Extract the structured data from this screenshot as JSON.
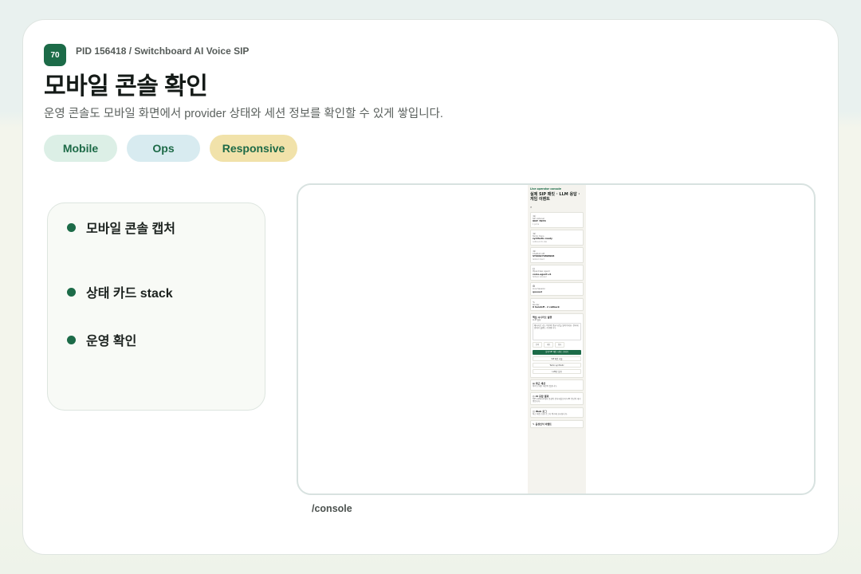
{
  "header": {
    "badge": "70",
    "pid": "PID 156418 / Switchboard AI Voice SIP",
    "title": "모바일 콘솔 확인",
    "subtitle": "운영 콘솔도 모바일 화면에서 provider 상태와 세션 정보를 확인할 수 있게 쌓입니다."
  },
  "tags": [
    "Mobile",
    "Ops",
    "Responsive"
  ],
  "checklist": [
    "모바일 콘솔 캡처",
    "상태 카드 stack",
    "운영 확인"
  ],
  "route": "/console",
  "phone": {
    "top_label": "Live operator console",
    "title": "실제 SIP 패킷 · LLM 응답 · 게임 이벤트",
    "search_icon": "⌕",
    "status_cards": [
      {
        "icon": "☏",
        "label": "SIP Listener",
        "value": "UDP :5070",
        "note": "1 pcma"
      },
      {
        "icon": "☏",
        "label": "Twilio trans",
        "value": "synthetic-ready",
        "note": "outbound to dial"
      },
      {
        "icon": "☏",
        "label": "Chatbot API",
        "value": "ST000279898908",
        "note": "talkbot intent"
      },
      {
        "icon": "◻",
        "label": "OpenClaw Agent",
        "value": "voice-agent-v1",
        "note": "fallback allowed"
      },
      {
        "icon": "⚙",
        "label": "Live Session",
        "value": "queued",
        "note": ""
      },
      {
        "icon": "∿",
        "label": "Router",
        "value": "0 handoff · 2 callback",
        "note": ""
      }
    ],
    "scenario": {
      "title": "핵심 시나리오 실행",
      "subtitle": "LLM 발화",
      "placeholder": "배터리로 가능 여부와 평균시간을 알려주세요. 결과에 맞춰서 플랜도 추천합니다.",
      "chips": [
        "문의",
        "재팅",
        "정지"
      ],
      "primary": "실제 SIP 패킷 시퀀스 보내기",
      "buttons": [
        "SIP 패킷 리플",
        "Twilio synthetic",
        "LLM만 실행"
      ]
    },
    "sections": [
      {
        "icon": "▤",
        "title": "최근 세션",
        "text": "아직 보내진 세션이 없습니다."
      },
      {
        "icon": "◎",
        "title": "AI 응답 결과",
        "text": "SIP Listener에서 음성이 전사되었으며 LLM 응답이 대기 중입니다."
      },
      {
        "icon": "◫",
        "title": "Web 로그",
        "text": "최근 패킷 흐름 로그가 여기에 표시됩니다."
      },
      {
        "icon": "✎",
        "title": "음성인식 이벤트",
        "text": ""
      }
    ]
  },
  "colors": {
    "brand": "#1c6b48",
    "tag_mobile": "#dcefe6",
    "tag_ops": "#d8ebf0",
    "tag_responsive": "#f1e2aa"
  }
}
